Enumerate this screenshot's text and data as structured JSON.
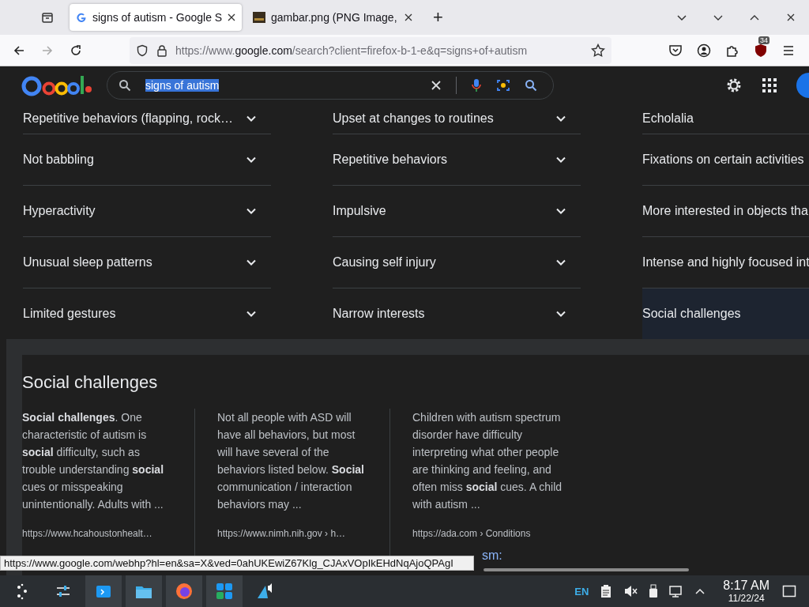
{
  "browser": {
    "tabs": [
      {
        "title": "signs of autism - Google S",
        "selected": true
      },
      {
        "title": "gambar.png (PNG Image, ",
        "selected": false
      }
    ],
    "new_tab": "+",
    "url": {
      "prefix": "https://www.",
      "host": "google.com",
      "path": "/search?client=firefox-b-1-e&q=signs+of+autism"
    },
    "extension_badge": "34"
  },
  "search": {
    "query": "signs of autism",
    "highlighted": true
  },
  "symptoms": {
    "columns": [
      [
        {
          "label": "Repetitive behaviors (flapping, rock…",
          "chevron": true,
          "selected": false
        },
        {
          "label": "Not babbling",
          "chevron": true,
          "selected": false
        },
        {
          "label": "Hyperactivity",
          "chevron": true,
          "selected": false
        },
        {
          "label": "Unusual sleep patterns",
          "chevron": true,
          "selected": false
        },
        {
          "label": "Limited gestures",
          "chevron": true,
          "selected": false
        }
      ],
      [
        {
          "label": "Upset at changes to routines",
          "chevron": true,
          "selected": false
        },
        {
          "label": "Repetitive behaviors",
          "chevron": true,
          "selected": false
        },
        {
          "label": "Impulsive",
          "chevron": true,
          "selected": false
        },
        {
          "label": "Causing self injury",
          "chevron": true,
          "selected": false
        },
        {
          "label": "Narrow interests",
          "chevron": true,
          "selected": false
        }
      ],
      [
        {
          "label": "Echolalia",
          "chevron": false,
          "selected": false
        },
        {
          "label": "Fixations on certain activities",
          "chevron": false,
          "selected": false
        },
        {
          "label": "More interested in objects tha",
          "chevron": false,
          "selected": false
        },
        {
          "label": "Intense and highly focused int",
          "chevron": false,
          "selected": false
        },
        {
          "label": "Social challenges",
          "chevron": false,
          "selected": true
        }
      ]
    ]
  },
  "panel": {
    "title": "Social challenges",
    "snippets": [
      {
        "text": "**Social challenges**. One characteristic of autism is **social** difficulty, such as trouble understanding **social** cues or misspeaking unintentionally. Adults with ...",
        "source": "https://www.hcahoustonhealt…"
      },
      {
        "text": "Not all people with ASD will have all behaviors, but most will have several of the behaviors listed below. **Social** communication / interaction behaviors may ...",
        "source": "https://www.nimh.nih.gov › h…"
      },
      {
        "text": "Children with autism spectrum disorder have difficulty interpreting what other people are thinking and feeling, and often miss **social** cues. A child with autism ...",
        "source": "https://ada.com › Conditions",
        "title": "sm:"
      }
    ]
  },
  "status_url": "https://www.google.com/webhp?hl=en&sa=X&ved=0ahUKEwiZ67Klg_CJAxVOpIkEHdNqAjoQPAgI",
  "taskbar": {
    "apps": [
      {
        "kind": "launcher",
        "active": false
      },
      {
        "kind": "settings",
        "active": false
      },
      {
        "kind": "remote",
        "active": true
      },
      {
        "kind": "files",
        "active": true
      },
      {
        "kind": "firefox",
        "active": true
      },
      {
        "kind": "grid",
        "active": true
      },
      {
        "kind": "audio",
        "active": false
      }
    ],
    "keyboard_layout": "EN",
    "time": "8:17 AM",
    "date": "11/22/24"
  }
}
